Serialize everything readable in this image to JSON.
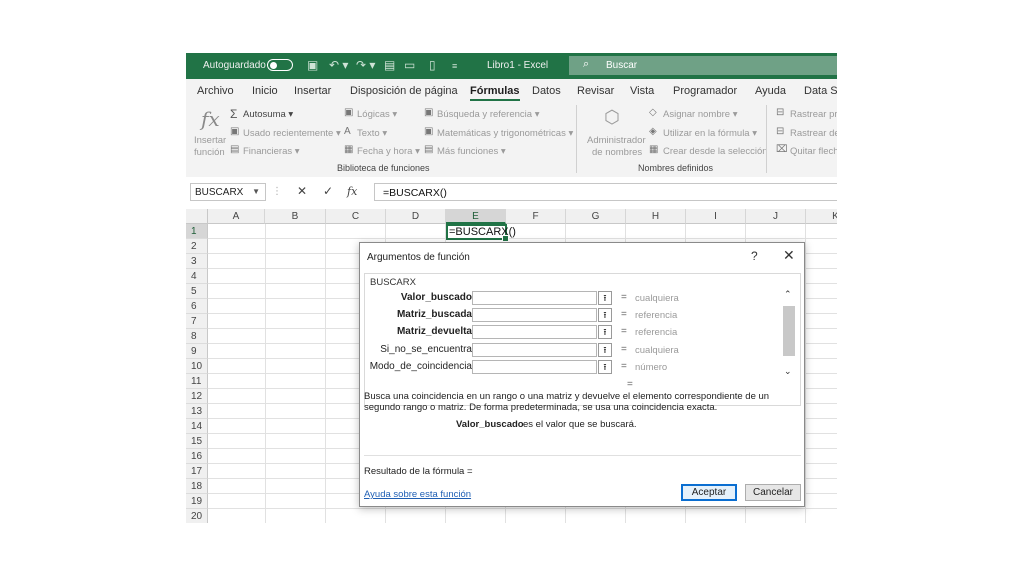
{
  "titlebar": {
    "autosave_label": "Autoguardado",
    "document_title": "Libro1  -  Excel",
    "search_placeholder": "Buscar"
  },
  "tabs": [
    {
      "label": "Archivo"
    },
    {
      "label": "Inicio"
    },
    {
      "label": "Insertar"
    },
    {
      "label": "Disposición de página"
    },
    {
      "label": "Fórmulas",
      "active": true
    },
    {
      "label": "Datos"
    },
    {
      "label": "Revisar"
    },
    {
      "label": "Vista"
    },
    {
      "label": "Programador"
    },
    {
      "label": "Ayuda"
    },
    {
      "label": "Data Str"
    }
  ],
  "ribbon": {
    "insert_function": {
      "line1": "Insertar",
      "line2": "función"
    },
    "autosum": "Autosuma",
    "recent": "Usado recientemente",
    "financial": "Financieras",
    "logical": "Lógicas",
    "text": "Texto",
    "datetime": "Fecha y hora",
    "lookup": "Búsqueda y referencia",
    "math": "Matemáticas y trigonométricas",
    "more": "Más funciones",
    "group_library": "Biblioteca de funciones",
    "name_manager": {
      "line1": "Administrador",
      "line2": "de nombres"
    },
    "assign_name": "Asignar nombre",
    "use_in_formula": "Utilizar en la fórmula",
    "create_from_selection": "Crear desde la selección",
    "group_names": "Nombres definidos",
    "trace_precedents": "Rastrear pre",
    "trace_dependents": "Rastrear dep",
    "remove_arrows": "Quitar flech"
  },
  "formula_bar": {
    "name_box": "BUSCARX",
    "formula": "=BUSCARX()"
  },
  "grid": {
    "columns": [
      "A",
      "B",
      "C",
      "D",
      "E",
      "F",
      "G",
      "H",
      "I",
      "J",
      "K"
    ],
    "rows": [
      "1",
      "2",
      "3",
      "4",
      "5",
      "6",
      "7",
      "8",
      "9",
      "10",
      "11",
      "12",
      "13",
      "14",
      "15",
      "16",
      "17",
      "18",
      "19",
      "20"
    ],
    "active_cell_value": "=BUSCARX()"
  },
  "dialog": {
    "title": "Argumentos de función",
    "help_glyph": "?",
    "close_glyph": "✕",
    "function_name": "BUSCARX",
    "arguments": [
      {
        "label": "Valor_buscado",
        "value": "cualquiera",
        "bold": true
      },
      {
        "label": "Matriz_buscada",
        "value": "referencia",
        "bold": true
      },
      {
        "label": "Matriz_devuelta",
        "value": "referencia",
        "bold": true
      },
      {
        "label": "Si_no_se_encuentra",
        "value": "cualquiera",
        "bold": false
      },
      {
        "label": "Modo_de_coincidencia",
        "value": "número",
        "bold": false
      }
    ],
    "equals_sign": "=",
    "description": "Busca una coincidencia en un rango o una matriz y devuelve el elemento correspondiente de un segundo rango o matriz. De forma predeterminada, se usa una coincidencia exacta.",
    "arg_description_name": "Valor_buscado",
    "arg_description_text": "es el valor que se buscará.",
    "result_label": "Resultado de la fórmula =",
    "help_link": "Ayuda sobre esta función",
    "ok_button": "Aceptar",
    "cancel_button": "Cancelar"
  }
}
